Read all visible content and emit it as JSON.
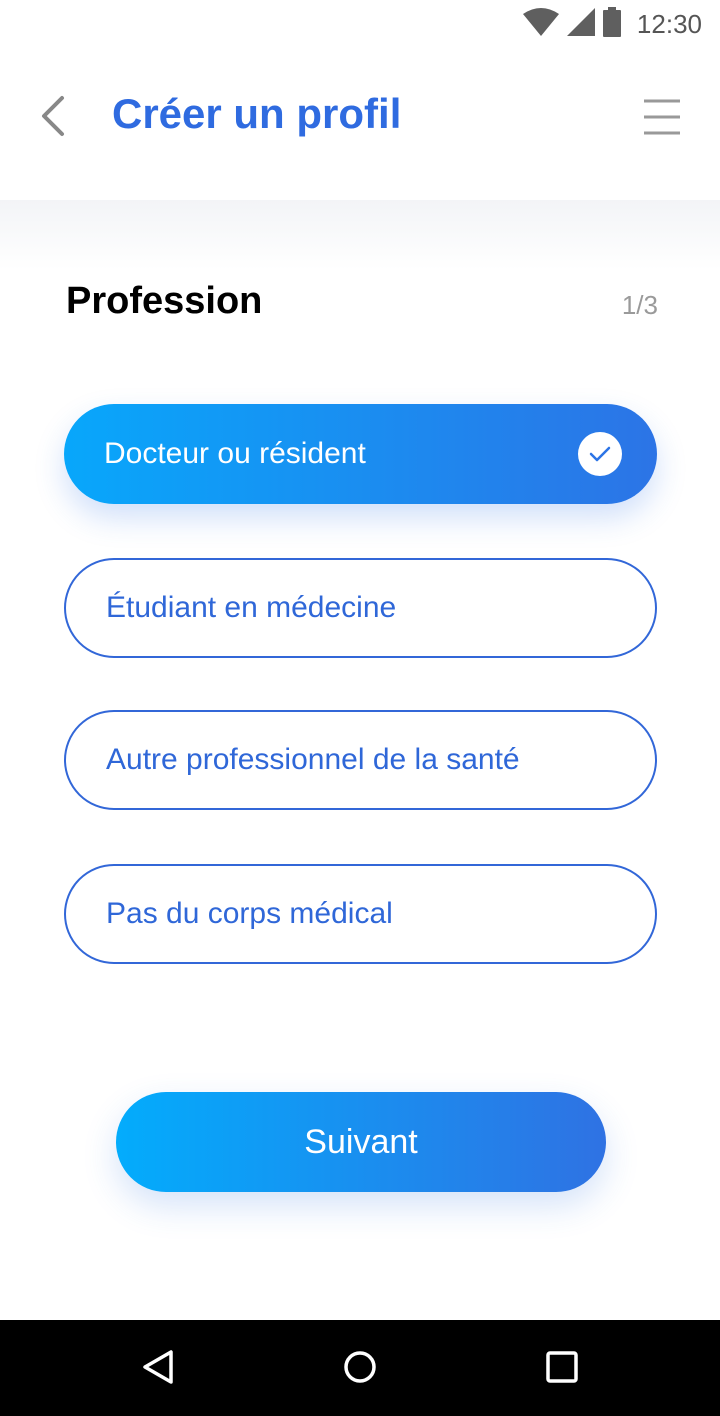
{
  "status_bar": {
    "time": "12:30",
    "icons": [
      "wifi-icon",
      "signal-icon",
      "battery-icon"
    ]
  },
  "app_bar": {
    "title": "Créer un profil",
    "back_icon": "chevron-left-icon",
    "menu_icon": "hamburger-menu-icon"
  },
  "section": {
    "title": "Profession",
    "step": "1/3"
  },
  "options": [
    {
      "label": "Docteur ou résident",
      "selected": true
    },
    {
      "label": "Étudiant en médecine",
      "selected": false
    },
    {
      "label": "Autre professionnel de la santé",
      "selected": false
    },
    {
      "label": "Pas du corps médical",
      "selected": false
    }
  ],
  "next_button": {
    "label": "Suivant"
  },
  "nav_bar": {
    "icons": [
      "back-triangle-icon",
      "home-circle-icon",
      "recents-square-icon"
    ]
  },
  "colors": {
    "accent": "#2f6be0",
    "gradient_start": "#08a7fb",
    "gradient_end": "#2c74e6"
  }
}
